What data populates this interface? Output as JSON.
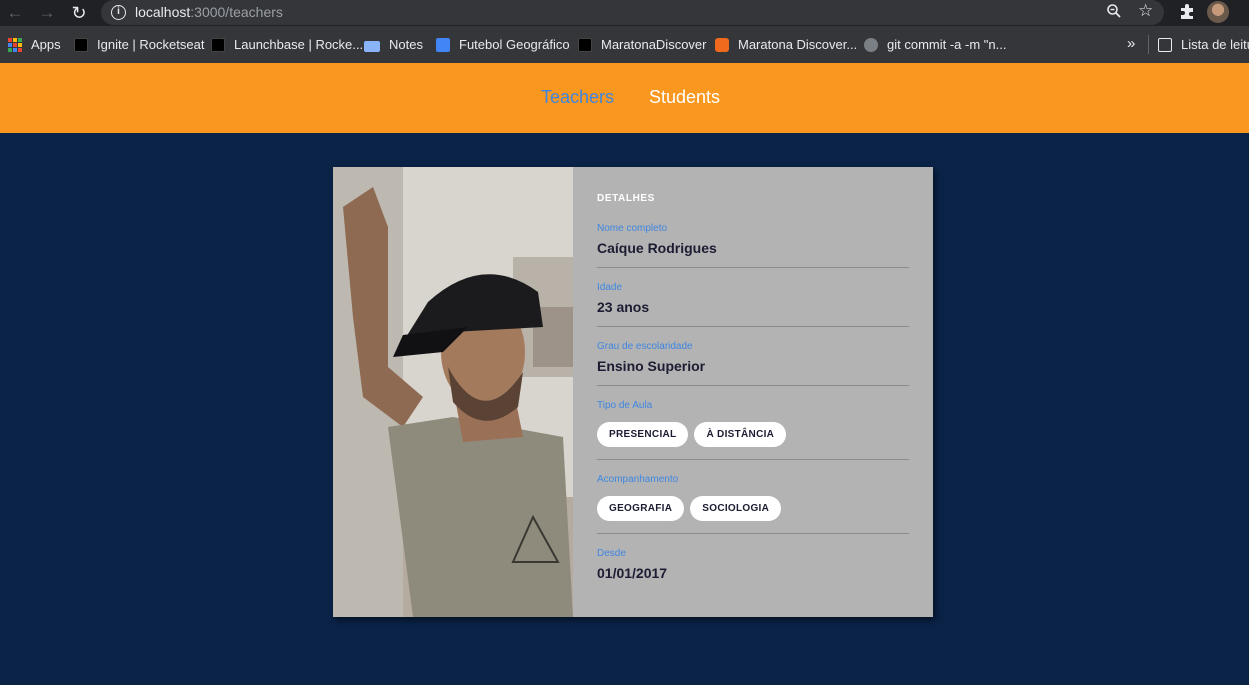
{
  "browser": {
    "url_host": "localhost",
    "url_rest": ":3000/teachers",
    "bookmarks": [
      {
        "label": "Apps",
        "icon": "apps-grid-icon"
      },
      {
        "label": "Ignite | Rocketseat",
        "icon": "rocketseat-icon"
      },
      {
        "label": "Launchbase | Rocke...",
        "icon": "rocketseat-icon"
      },
      {
        "label": "Notes",
        "icon": "laptop-icon"
      },
      {
        "label": "Futebol Geográfico",
        "icon": "docs-icon"
      },
      {
        "label": "MaratonaDiscover",
        "icon": "rocketseat-icon"
      },
      {
        "label": "Maratona Discover...",
        "icon": "youtube-icon"
      },
      {
        "label": "git commit -a -m \"n...",
        "icon": "github-icon"
      },
      {
        "label": "Lista de leitu",
        "icon": "reading-list-icon"
      }
    ]
  },
  "header": {
    "nav": [
      {
        "label": "Teachers",
        "active": true
      },
      {
        "label": "Students",
        "active": false
      }
    ],
    "color": "#f9971e"
  },
  "card": {
    "title": "Detalhes",
    "full_name_label": "Nome completo",
    "full_name": "Caíque Rodrigues",
    "age_label": "Idade",
    "age": "23 anos",
    "education_label": "Grau de escolaridade",
    "education": "Ensino Superior",
    "class_type_label": "Tipo de Aula",
    "class_types": [
      "Presencial",
      "À distância"
    ],
    "subjects_label": "Acompanhamento",
    "subjects": [
      "Geografia",
      "Sociologia"
    ],
    "since_label": "Desde",
    "since": "01/01/2017"
  },
  "colors": {
    "page_bg": "#0a2347",
    "accent_blue": "#3f86e0",
    "details_bg": "#b3b3b3"
  }
}
